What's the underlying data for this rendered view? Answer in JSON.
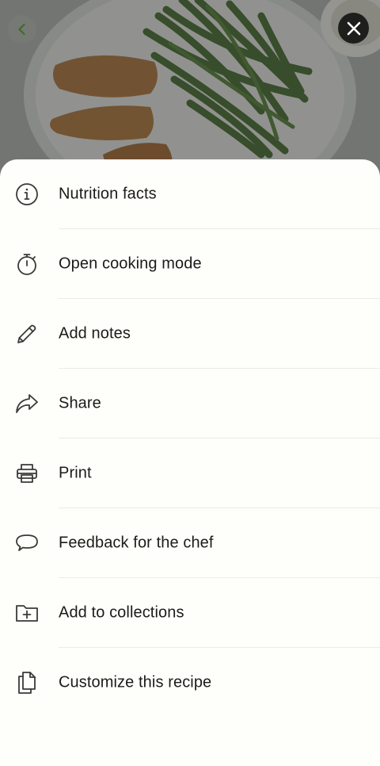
{
  "colors": {
    "sheet_background": "#fefefa",
    "text": "#1b1b19",
    "icon": "#3a3b38",
    "divider": "#ececE6",
    "close_button": "#1e1f1d",
    "back_chevron": "#3f6b2e"
  },
  "header": {
    "back_icon": "chevron-left-icon",
    "close_icon": "close-x-icon"
  },
  "menu": {
    "items": [
      {
        "label": "Nutrition facts",
        "icon": "info-icon"
      },
      {
        "label": "Open cooking mode",
        "icon": "stopwatch-icon"
      },
      {
        "label": "Add notes",
        "icon": "pencil-icon"
      },
      {
        "label": "Share",
        "icon": "share-arrow-icon"
      },
      {
        "label": "Print",
        "icon": "printer-icon"
      },
      {
        "label": "Feedback for the chef",
        "icon": "speech-bubble-icon"
      },
      {
        "label": "Add to collections",
        "icon": "folder-plus-icon"
      },
      {
        "label": "Customize this recipe",
        "icon": "copy-pages-icon"
      }
    ]
  }
}
